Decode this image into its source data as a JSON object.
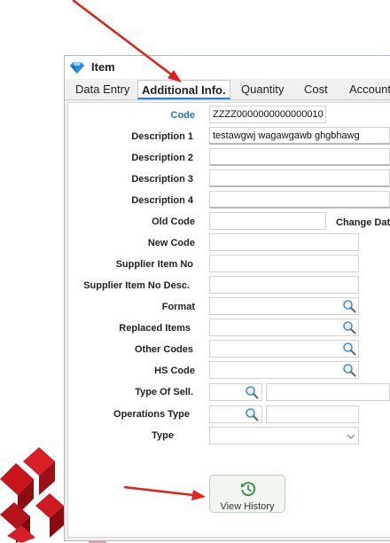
{
  "window": {
    "title": "Item",
    "icon": "diamond-icon"
  },
  "tabs": [
    {
      "label": "Data Entry",
      "active": false
    },
    {
      "label": "Additional Info.",
      "active": true
    },
    {
      "label": "Quantity",
      "active": false
    },
    {
      "label": "Cost",
      "active": false
    },
    {
      "label": "Accounts",
      "active": false
    }
  ],
  "form": {
    "code": {
      "label": "Code",
      "value": "ZZZZ0000000000000010"
    },
    "description1": {
      "label": "Description 1",
      "value": "testawgwj wagawgawb ghgbhawg"
    },
    "description2": {
      "label": "Description 2",
      "value": ""
    },
    "description3": {
      "label": "Description 3",
      "value": ""
    },
    "description4": {
      "label": "Description 4",
      "value": ""
    },
    "old_code": {
      "label": "Old Code",
      "value": ""
    },
    "change_date": {
      "label": "Change Date"
    },
    "new_code": {
      "label": "New Code",
      "value": ""
    },
    "supplier_item_no": {
      "label": "Supplier Item No",
      "value": ""
    },
    "supplier_item_desc": {
      "label": "Supplier Item No Desc.",
      "value": ""
    },
    "format": {
      "label": "Format",
      "value": ""
    },
    "replaced_items": {
      "label": "Replaced Items",
      "value": ""
    },
    "other_codes": {
      "label": "Other Codes",
      "value": ""
    },
    "hs_code": {
      "label": "HS Code",
      "value": ""
    },
    "type_of_sell": {
      "label": "Type Of Sell.",
      "value": ""
    },
    "operations_type": {
      "label": "Operations Type",
      "value": ""
    },
    "type": {
      "label": "Type",
      "value": ""
    }
  },
  "buttons": {
    "view_history": "View History"
  },
  "colors": {
    "accent": "#1e88d6",
    "code_label": "#1a78c2",
    "annotation_arrow": "#e3201b",
    "history_icon": "#2e8b3a"
  }
}
